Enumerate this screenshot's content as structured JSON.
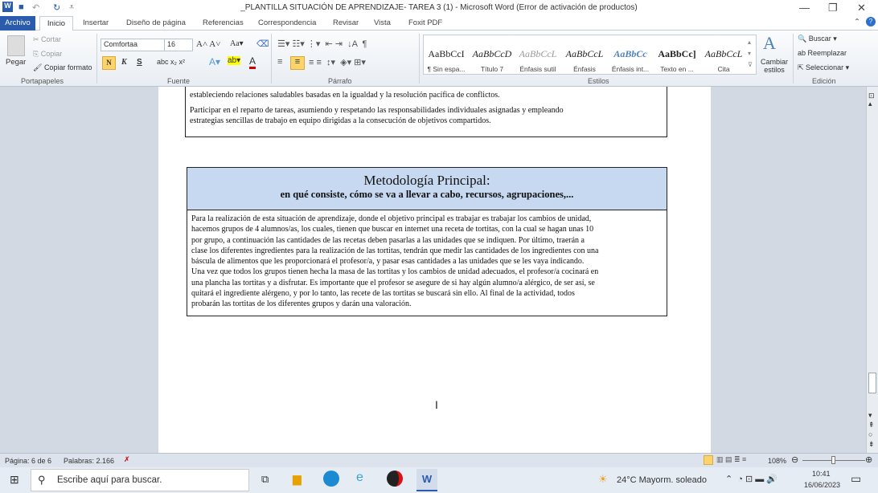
{
  "window": {
    "title": "_PLANTILLA SITUACIÓN DE APRENDIZAJE- TAREA 3 (1)  -  Microsoft Word (Error de activación de productos)"
  },
  "tabs": [
    "Archivo",
    "Inicio",
    "Insertar",
    "Diseño de página",
    "Referencias",
    "Correspondencia",
    "Revisar",
    "Vista",
    "Foxit PDF"
  ],
  "clipboard": {
    "paste": "Pegar",
    "cut": "Cortar",
    "copy": "Copiar",
    "format_painter": "Copiar formato",
    "group": "Portapapeles"
  },
  "font": {
    "name": "Comfortaa",
    "size": "16",
    "group": "Fuente",
    "bold": "N",
    "italic": "K",
    "underline": "S"
  },
  "paragraph": {
    "group": "Párrafo"
  },
  "styles": {
    "group": "Estilos",
    "items": [
      {
        "sample": "AaBbCcI",
        "label": "¶ Sin espa..."
      },
      {
        "sample": "AaBbCcD",
        "label": "Título 7"
      },
      {
        "sample": "AaBbCcL",
        "label": "Énfasis sutil"
      },
      {
        "sample": "AaBbCcL",
        "label": "Énfasis"
      },
      {
        "sample": "AaBbCc",
        "label": "Énfasis int..."
      },
      {
        "sample": "AaBbCc]",
        "label": "Texto en ..."
      },
      {
        "sample": "AaBbCcL",
        "label": "Cita"
      }
    ],
    "change": "Cambiar estilos"
  },
  "editing": {
    "group": "Edición",
    "find": "Buscar",
    "replace": "Reemplazar",
    "select": "Seleccionar"
  },
  "doc": {
    "box1_lines": [
      "estableciendo  relaciones  saludables  basadas  en la igualdad  y la resolución  pacífica  de conflictos.",
      "Participar  en el reparto de tareas,  asumiendo  y respetando  las responsabilidades  individuales  asignadas  y empleando",
      "estrategias  sencillas  de trabajo en equipo  dirigidas  a la consecución  de objetivos  compartidos."
    ],
    "box2_title": "Metodología Principal:",
    "box2_subtitle": "en qué consiste, cómo se va a llevar a cabo, recursos, agrupaciones,...",
    "box2_lines": [
      "Para la realización  de esta situación de aprendizaje,  donde el objetivo principal es trabajar es trabajar los cambios de unidad,",
      "hacemos grupos de 4 alumnos/as,  los cuales,  tienen que buscar en internet una receta de tortitas, con la cual se hagan unas 10",
      "por grupo, a continuación  las cantidades de las recetas deben pasarlas a las unidades que se indiquen.  Por último,  traerán a",
      "clase los diferentes  ingredientes para la realización  de las tortitas,  tendrán que medir las cantidades  de los ingredientes  con una",
      "báscula  de alimentos que les proporcionará el profesor/a,  y pasar esas cantidades  a las unidades que se les vaya indicando.",
      "Una vez que todos los grupos tienen hecha la masa de las tortitas y los cambios de unidad adecuados,  el profesor/a cocinará en",
      "una plancha  las tortitas y a disfrutar.  Es importante que el profesor se asegure de si hay algún alumno/a alérgico,  de ser así,  se",
      "quitará el ingrediente alérgeno,  y por lo tanto,  las recete de las tortitas se buscará  sin ello.  Al final de la actividad,  todos",
      "probarán las tortitas de los diferentes  grupos y darán una valoración."
    ]
  },
  "status": {
    "page": "Página: 6 de 6",
    "words": "Palabras: 2.166",
    "zoom": "108%"
  },
  "taskbar": {
    "search_placeholder": "Escribe aquí para buscar.",
    "weather": "24°C  Mayorm. soleado",
    "time": "10:41",
    "date": "16/06/2023"
  }
}
